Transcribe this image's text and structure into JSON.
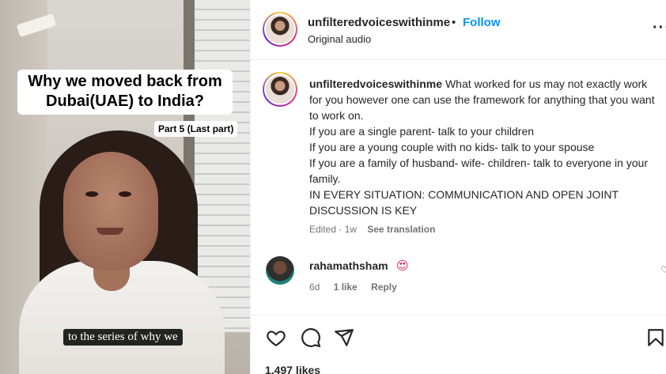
{
  "video": {
    "title": "Why we moved back from Dubai(UAE) to India?",
    "part_label": "Part 5 (Last part)",
    "subtitle": "to the series of why we"
  },
  "header": {
    "username": "unfilteredvoiceswithinme",
    "separator": "•",
    "follow_label": "Follow",
    "audio_label": "Original audio",
    "more_icon": "more-options-icon"
  },
  "caption": {
    "username": "unfilteredvoiceswithinme",
    "lines": [
      "What worked for us may not exactly work for you however one can use the framework for anything that you want to work on.",
      "If you are a single parent- talk to your children",
      "If you are a young couple with no kids- talk to your spouse",
      "If you are a family of husband- wife- children- talk to everyone in your family.",
      "IN EVERY SITUATION: COMMUNICATION AND OPEN JOINT DISCUSSION IS KEY"
    ],
    "meta_edited": "Edited · 1w",
    "see_translation": "See translation"
  },
  "comment": {
    "username": "rahamathsham",
    "emoji": "😍",
    "time": "6d",
    "likes": "1 like",
    "reply": "Reply"
  },
  "actions": {
    "icons": [
      "heart-icon",
      "comment-icon",
      "share-icon",
      "bookmark-icon"
    ],
    "likes_count": "1,497 likes"
  }
}
